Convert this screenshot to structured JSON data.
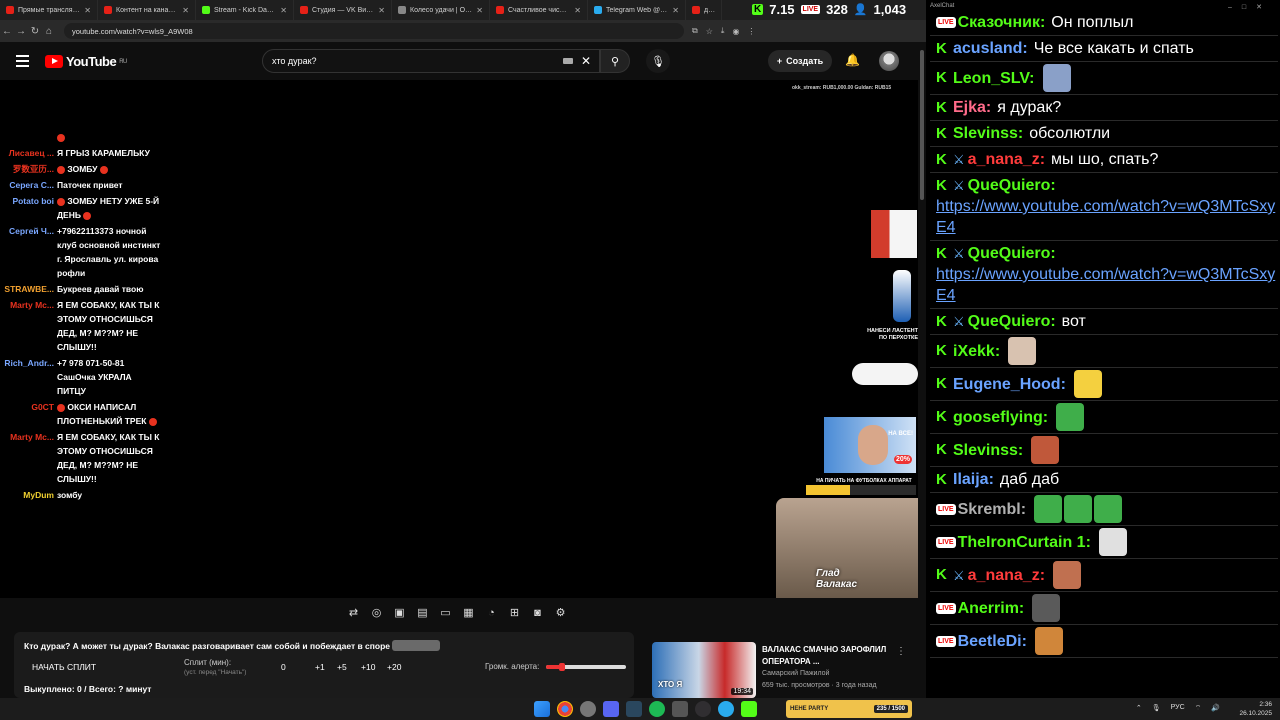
{
  "browser": {
    "tabs": [
      {
        "title": "Прямые трансляции -",
        "color": "#e62117"
      },
      {
        "title": "Контент на канале - Y",
        "color": "#e62117"
      },
      {
        "title": "Stream - Kick Dashboard",
        "color": "#53fc18"
      },
      {
        "title": "Студия — VK Видео Li",
        "color": "#e62117"
      },
      {
        "title": "Колесо удачи | Опред",
        "color": "#888888"
      },
      {
        "title": "Счастливое число Сле",
        "color": "#e62117"
      },
      {
        "title": "Telegram Web @The_L",
        "color": "#2aabee"
      },
      {
        "title": "дур",
        "color": "#e62117"
      }
    ],
    "url": "youtube.com/watch?v=wls9_A9W08"
  },
  "overlay_stats": {
    "kick_count": "7.15",
    "live_label": "LIVE",
    "live_count": "328",
    "viewers": "1,043"
  },
  "youtube": {
    "logo_text": "YouTube",
    "logo_region": "RU",
    "search_query": "хто дурак?",
    "create_label": "Создать"
  },
  "video": {
    "donators": "okk_stream: RUB1,000.00   Guldan: RUB15",
    "stream_chat": [
      {
        "name": "",
        "text": "",
        "dot": true,
        "color": "#e8321f"
      },
      {
        "name": "Лисавец ...",
        "text": "Я ГРЫЗ КАРАМЕЛЬКУ",
        "color": "#e8321f"
      },
      {
        "name": "罗数亚历...",
        "text": "ЗОМБУ",
        "dots": true,
        "color": "#e8321f"
      },
      {
        "name": "Серега С...",
        "text": "Паточек привет",
        "color": "#7aa7ff"
      },
      {
        "name": "Potato boi",
        "text": "ЗОМБУ НЕТУ УЖЕ 5-Й ДЕНЬ",
        "dots": true,
        "color": "#7aa7ff"
      },
      {
        "name": "Сергей Ч...",
        "text": "+79622113373 ночной клуб основной инстинкт г. Ярославль ул. кирова рофли",
        "color": "#7aa7ff"
      },
      {
        "name": "STRAWBE...",
        "text": "Букреев давай твою",
        "color": "#f0a030"
      },
      {
        "name": "Marty Mc...",
        "text": "Я ЕМ СОБАКУ, КАК ТЫ К ЭТОМУ ОТНОСИШЬСЯ ДЕД, М? М??М? НЕ СЛЫШУ!!",
        "color": "#e8321f"
      },
      {
        "name": "Rich_Andr...",
        "text": "+7 978 071-50-81 СашОчка УКРАЛА ПИТЦУ",
        "color": "#7aa7ff"
      },
      {
        "name": "G0CT",
        "text": "ОКСИ НАПИСАЛ ПЛОТНЕНЬКИЙ ТРЕК",
        "dots": true,
        "color": "#e8321f"
      },
      {
        "name": "Marty Mc...",
        "text": "Я ЕМ СОБАКУ, КАК ТЫ К ЭТОМУ ОТНОСИШЬСЯ ДЕД, М? М??М? НЕ СЛЫШУ!!",
        "color": "#e8321f"
      },
      {
        "name": "MyDum",
        "text": "зомбу",
        "color": "#f0d030"
      }
    ],
    "ad_text_1": "НАНЕСИ ЛАСТЕНТ ПО ПЕРХОТКЕ",
    "ad_text_2": "НА ПИЧАТЬ НА ФУТБОЛКАХ АППАРАТ",
    "overlay_caption": "Глад Валакас",
    "percent_badge": "20%",
    "promo_badge": "НА ВСЕ!"
  },
  "below": {
    "title": "Кто дурак? А может ты дурак? Валакас разговаривает сам собой и побеждает в споре",
    "start_split": "НАЧАТЬ СПЛИТ",
    "split_label": "Сплит (мин):",
    "split_sub": "(уст. перед \"Начать\")",
    "split_value": "0",
    "steps": [
      "+1",
      "+5",
      "+10",
      "+20"
    ],
    "volume_label": "Громк. алерта:",
    "volume_level": 0.2,
    "bought": "Выкуплено: 0 / Всего: ? минут"
  },
  "recommendation": {
    "title": "ВАЛАКАС СМАЧНО ЗАРОФЛИЛ ОПЕРАТОРА ...",
    "channel": "Самарский Пажилой",
    "meta": "659 тыс. просмотров · 3 года назад",
    "duration": "19:34",
    "thumb_text": "ХТО Я"
  },
  "chat": {
    "window_title": "AxelChat",
    "messages": [
      {
        "platform": "live",
        "name": "Сказочник:",
        "color": "#53fc18",
        "text": "Он поплыл"
      },
      {
        "platform": "kick",
        "name": "acusland:",
        "color": "#6aa3ff",
        "text": "Че все какать и спать"
      },
      {
        "platform": "kick",
        "name": "Leon_SLV:",
        "color": "#53fc18",
        "text": "",
        "emote": "#8aa0c8"
      },
      {
        "platform": "kick",
        "name": "Ejka:",
        "color": "#ff6b8a",
        "text": "я дурак?"
      },
      {
        "platform": "kick",
        "name": "Slevinss:",
        "color": "#53fc18",
        "text": "обсолютли"
      },
      {
        "platform": "kick",
        "mod": true,
        "name": "a_nana_z:",
        "color": "#ff3b3b",
        "text": "мы шо, спать?"
      },
      {
        "platform": "kick",
        "mod": true,
        "name": "QueQuiero:",
        "color": "#53fc18",
        "text": "",
        "link": "https://www.youtube.com/watch?v=wQ3MTcSxyE4"
      },
      {
        "platform": "kick",
        "mod": true,
        "name": "QueQuiero:",
        "color": "#53fc18",
        "text": "",
        "link": "https://www.youtube.com/watch?v=wQ3MTcSxyE4"
      },
      {
        "platform": "kick",
        "mod": true,
        "name": "QueQuiero:",
        "color": "#53fc18",
        "text": "вот"
      },
      {
        "platform": "kick",
        "name": "iXekk:",
        "color": "#53fc18",
        "text": "",
        "emote": "#d8c2b0"
      },
      {
        "platform": "kick",
        "name": "Eugene_Hood:",
        "color": "#6aa3ff",
        "text": "",
        "emote": "#f4d03f"
      },
      {
        "platform": "kick",
        "name": "gooseflying:",
        "color": "#53fc18",
        "text": "",
        "emote": "#3fae4a"
      },
      {
        "platform": "kick",
        "name": "Slevinss:",
        "color": "#53fc18",
        "text": "",
        "emote": "#c0583a"
      },
      {
        "platform": "kick",
        "name": "Ilaija:",
        "color": "#6aa3ff",
        "text": "даб даб"
      },
      {
        "platform": "live",
        "name": "Skrembl:",
        "color": "#b0b0b0",
        "text": "",
        "emotes": [
          "#3fae4a",
          "#3fae4a",
          "#3fae4a"
        ]
      },
      {
        "platform": "live",
        "name": "TheIronCurtain 1:",
        "color": "#53fc18",
        "text": "",
        "emote": "#e0e0e0"
      },
      {
        "platform": "kick",
        "mod": true,
        "name": "a_nana_z:",
        "color": "#ff3b3b",
        "text": "",
        "emote": "#c07050"
      },
      {
        "platform": "live",
        "name": "Anerrim:",
        "color": "#53fc18",
        "text": "",
        "emote": "#5a5a5a"
      },
      {
        "platform": "live",
        "name": "BeetleDi:",
        "color": "#6aa3ff",
        "text": "",
        "emote": "#d0863a"
      }
    ]
  },
  "taskbar": {
    "banner_left": "HEHE PARTY",
    "banner_right": "235 / 1500",
    "lang": "РУС",
    "time": "2:36",
    "date": "26.10.2025"
  }
}
